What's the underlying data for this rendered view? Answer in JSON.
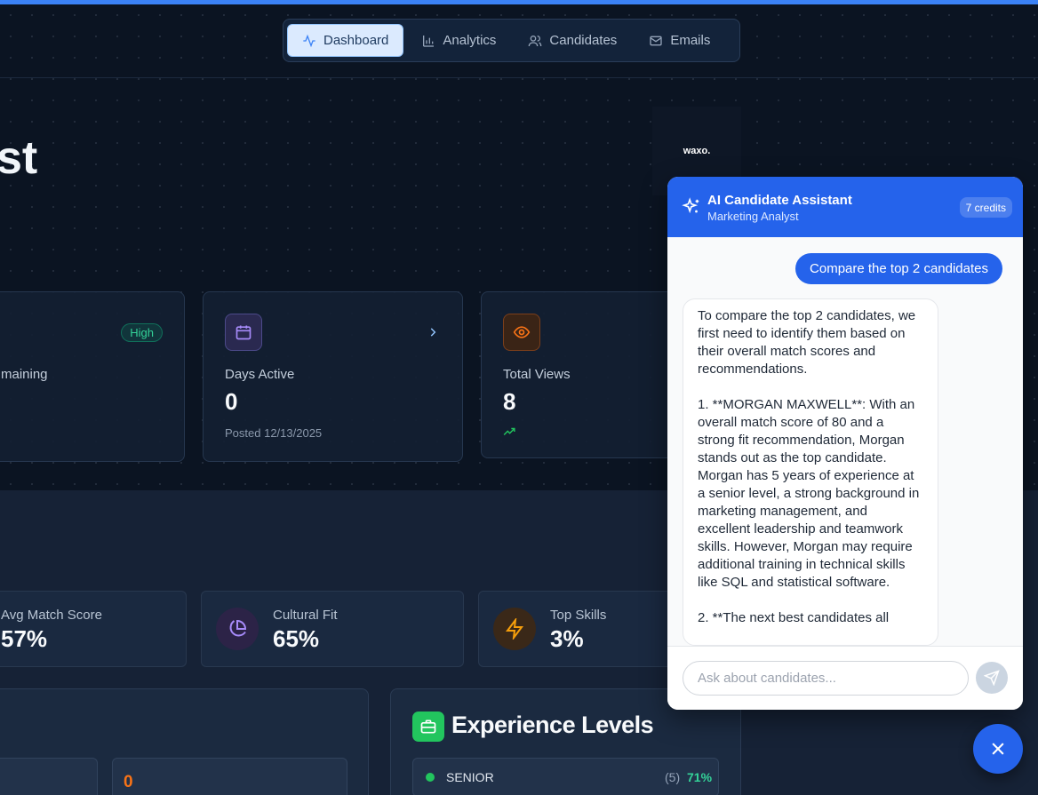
{
  "nav": {
    "items": [
      {
        "label": "Dashboard",
        "icon": "activity-icon",
        "active": true
      },
      {
        "label": "Analytics",
        "icon": "bar-chart-icon",
        "active": false
      },
      {
        "label": "Candidates",
        "icon": "users-icon",
        "active": false
      },
      {
        "label": "Emails",
        "icon": "mail-icon",
        "active": false
      }
    ]
  },
  "hero": {
    "title_fragment": "st",
    "company_logo": "waxo."
  },
  "stats": {
    "remaining": {
      "label": "maining",
      "badge": "High"
    },
    "days_active": {
      "label": "Days Active",
      "value": "0",
      "sub": "Posted 12/13/2025"
    },
    "total_views": {
      "label": "Total Views",
      "value": "8"
    }
  },
  "metrics": {
    "avg_match": {
      "label": "Avg Match Score",
      "value": "57%"
    },
    "cultural_fit": {
      "label": "Cultural Fit",
      "value": "65%"
    },
    "top_skills": {
      "label": "Top Skills",
      "value": "3%"
    }
  },
  "panels": {
    "left_value": "0",
    "experience": {
      "title": "Experience Levels",
      "rows": [
        {
          "level": "SENIOR",
          "count": "(5)",
          "percent": "71%"
        }
      ]
    }
  },
  "chat": {
    "title": "AI Candidate Assistant",
    "subtitle": "Marketing Analyst",
    "credits": "7 credits",
    "user_message": "Compare the top 2 candidates",
    "assistant_message": "To compare the top 2 candidates, we first need to identify them based on their overall match scores and recommendations.\n\n1. **MORGAN MAXWELL**: With an overall match score of 80 and a strong fit recommendation, Morgan stands out as the top candidate. Morgan has 5 years of experience at a senior level, a strong background in marketing management, and excellent leadership and teamwork skills. However, Morgan may require additional training in technical skills like SQL and statistical software.\n\n2. **The next best candidates all",
    "input_placeholder": "Ask about candidates..."
  },
  "colors": {
    "accent": "#2563eb",
    "success": "#22c55e",
    "warning": "#f97316",
    "purple": "#a78bfa"
  }
}
